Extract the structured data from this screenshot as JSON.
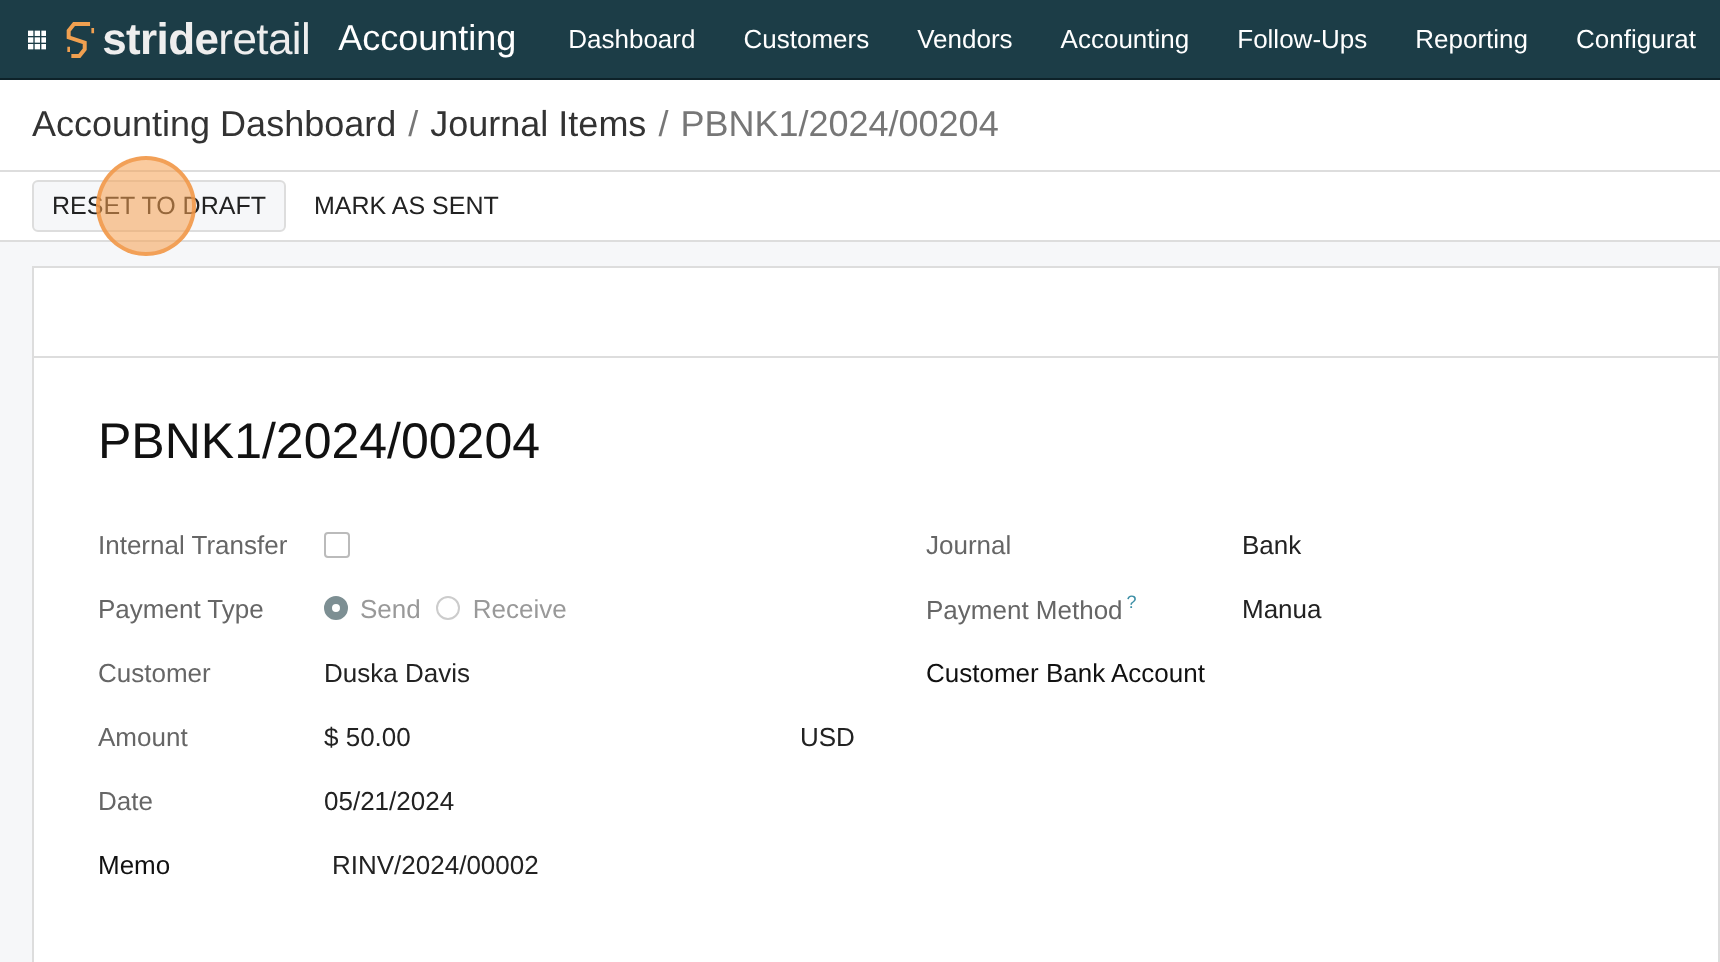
{
  "navbar": {
    "brand": "**stride**retail",
    "app": "Accounting",
    "menu": [
      {
        "label": "Dashboard"
      },
      {
        "label": "Customers"
      },
      {
        "label": "Vendors"
      },
      {
        "label": "Accounting"
      },
      {
        "label": "Follow-Ups"
      },
      {
        "label": "Reporting"
      },
      {
        "label": "Configurat"
      }
    ]
  },
  "breadcrumb": {
    "separator": "/",
    "items": [
      {
        "label": "Accounting Dashboard",
        "current": false
      },
      {
        "label": "Journal Items",
        "current": false
      },
      {
        "label": "PBNK1/2024/00204",
        "current": true
      }
    ]
  },
  "actions": [
    {
      "label": "RESET TO DRAFT",
      "bordered": true,
      "clicked": true
    },
    {
      "label": "MARK AS SENT",
      "bordered": false,
      "clicked": false
    }
  ],
  "record": {
    "title": "PBNK1/2024/00204",
    "left_fields": [
      {
        "label": "Internal Transfer",
        "kind": "checkbox",
        "readonly": true,
        "checked": false
      },
      {
        "label": "Payment Type",
        "kind": "radio",
        "readonly": true,
        "options": [
          {
            "label": "Send",
            "selected": true
          },
          {
            "label": "Receive",
            "selected": false
          }
        ]
      },
      {
        "label": "Customer",
        "kind": "text",
        "readonly": true,
        "value": "Duska Davis"
      },
      {
        "label": "Amount",
        "kind": "amount",
        "readonly": true,
        "value": "$ 50.00",
        "currency": "USD"
      },
      {
        "label": "Date",
        "kind": "text",
        "readonly": true,
        "value": "05/21/2024"
      },
      {
        "label": "Memo",
        "kind": "text",
        "readonly": false,
        "value": "RINV/2024/00002"
      }
    ],
    "right_fields": [
      {
        "label": "Journal",
        "kind": "text",
        "readonly": true,
        "value": "Bank"
      },
      {
        "label": "Payment Method",
        "kind": "text",
        "readonly": true,
        "value": "Manua",
        "help": "?"
      },
      {
        "label": "Customer Bank Account",
        "kind": "empty",
        "readonly": false
      }
    ]
  }
}
